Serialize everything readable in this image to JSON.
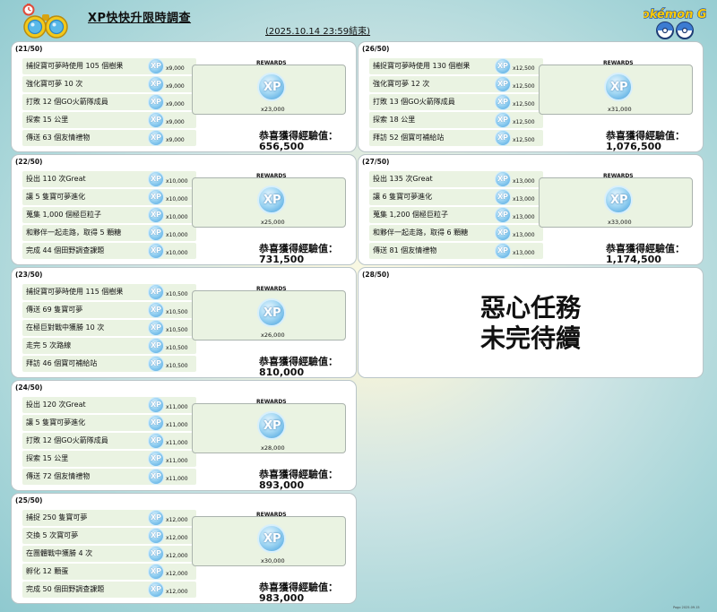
{
  "header": {
    "title": "XP快快升限時調查",
    "subtitle": "(2025.10.14 23:59結束)",
    "logo_text": "Pokémon GO"
  },
  "labels": {
    "rewards": "REWARDS",
    "congrats": "恭喜獲得經驗值：",
    "xp_icon": "XP"
  },
  "colors": {
    "card_border": "#b9c5c8",
    "task_background": "#eaf3e2",
    "xp_blue": "#4aa4de",
    "binocular_gold": "#f3c81a",
    "background_teal": "#a9d6d9"
  },
  "icons": [
    "binoculars-icon",
    "stopwatch-icon",
    "xp-icon",
    "pokemon-go-logo"
  ],
  "cards": [
    {
      "num": "(21/50)",
      "tasks": [
        {
          "label": "捕捉寶可夢時使用 105 個樹果",
          "xp": "x9,000"
        },
        {
          "label": "強化寶可夢 10 次",
          "xp": "x9,000"
        },
        {
          "label": "打敗 12 個GO火箭隊成員",
          "xp": "x9,000"
        },
        {
          "label": "探索 15 公里",
          "xp": "x9,000"
        },
        {
          "label": "傳送 63 個友情禮物",
          "xp": "x9,000"
        }
      ],
      "reward": "x23,000",
      "total": "656,500"
    },
    {
      "num": "(26/50)",
      "tasks": [
        {
          "label": "捕捉寶可夢時使用 130 個樹果",
          "xp": "x12,500"
        },
        {
          "label": "強化寶可夢 12 次",
          "xp": "x12,500"
        },
        {
          "label": "打敗 13 個GO火箭隊成員",
          "xp": "x12,500"
        },
        {
          "label": "探索 18 公里",
          "xp": "x12,500"
        },
        {
          "label": "拜訪 52 個寶可補給站",
          "xp": "x12,500"
        }
      ],
      "reward": "x31,000",
      "total": "1,076,500"
    },
    {
      "num": "(22/50)",
      "tasks": [
        {
          "label": "投出 110 次Great",
          "xp": "x10,000"
        },
        {
          "label": "讓 5 隻寶可夢進化",
          "xp": "x10,000"
        },
        {
          "label": "蒐集 1,000 個極巨粒子",
          "xp": "x10,000"
        },
        {
          "label": "和夥伴一起走路，取得 5 顆糖",
          "xp": "x10,000"
        },
        {
          "label": "完成 44 個田野調查課題",
          "xp": "x10,000"
        }
      ],
      "reward": "x25,000",
      "total": "731,500"
    },
    {
      "num": "(27/50)",
      "tasks": [
        {
          "label": "投出 135 次Great",
          "xp": "x13,000"
        },
        {
          "label": "讓 6 隻寶可夢進化",
          "xp": "x13,000"
        },
        {
          "label": "蒐集 1,200 個極巨粒子",
          "xp": "x13,000"
        },
        {
          "label": "和夥伴一起走路，取得 6 顆糖",
          "xp": "x13,000"
        },
        {
          "label": "傳送 81 個友情禮物",
          "xp": "x13,000"
        }
      ],
      "reward": "x33,000",
      "total": "1,174,500"
    },
    {
      "num": "(23/50)",
      "tasks": [
        {
          "label": "捕捉寶可夢時使用 115 個樹果",
          "xp": "x10,500"
        },
        {
          "label": "傳送 69 隻寶可夢",
          "xp": "x10,500"
        },
        {
          "label": "在極巨對戰中獲勝 10 次",
          "xp": "x10,500"
        },
        {
          "label": "走完 5 次路線",
          "xp": "x10,500"
        },
        {
          "label": "拜訪 46 個寶可補給站",
          "xp": "x10,500"
        }
      ],
      "reward": "x26,000",
      "total": "810,000"
    },
    {
      "num": "(28/50)",
      "pending_line1": "惡心任務",
      "pending_line2": "未完待續"
    },
    {
      "num": "(24/50)",
      "tasks": [
        {
          "label": "投出 120 次Great",
          "xp": "x11,000"
        },
        {
          "label": "讓 5 隻寶可夢進化",
          "xp": "x11,000"
        },
        {
          "label": "打敗 12 個GO火箭隊成員",
          "xp": "x11,000"
        },
        {
          "label": "探索 15 公里",
          "xp": "x11,000"
        },
        {
          "label": "傳送 72 個友情禮物",
          "xp": "x11,000"
        }
      ],
      "reward": "x28,000",
      "total": "893,000"
    },
    {
      "num": "(25/50)",
      "tasks": [
        {
          "label": "捕捉 250 隻寶可夢",
          "xp": "x12,000"
        },
        {
          "label": "交換 5 次寶可夢",
          "xp": "x12,000"
        },
        {
          "label": "在團體戰中獲勝 4 次",
          "xp": "x12,000"
        },
        {
          "label": "孵化 12 顆蛋",
          "xp": "x12,000"
        },
        {
          "label": "完成 50 個田野調查課題",
          "xp": "x12,000"
        }
      ],
      "reward": "x30,000",
      "total": "983,000"
    }
  ],
  "footer_note": "Pogo 2025.09.15"
}
